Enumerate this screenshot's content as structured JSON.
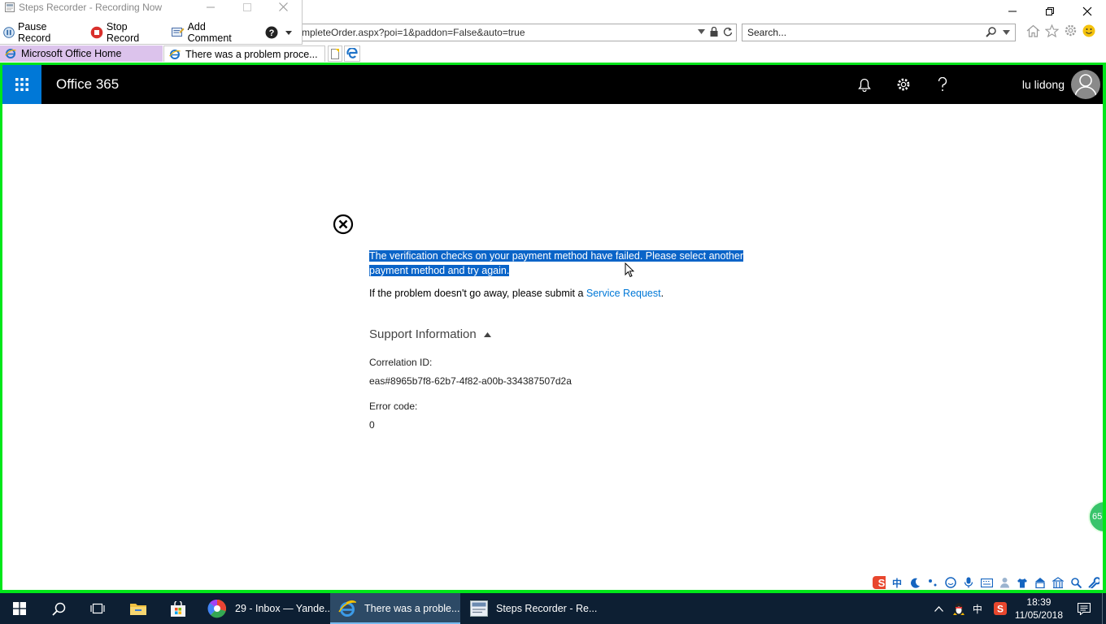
{
  "steps_recorder": {
    "title": "Steps Recorder - Recording Now",
    "pause_label": "Pause Record",
    "stop_label": "Stop Record",
    "comment_label": "Add Comment"
  },
  "browser": {
    "url": "mpleteOrder.aspx?poi=1&paddon=False&auto=true",
    "search_placeholder": "Search...",
    "tabs": [
      {
        "label": "Microsoft Office Home"
      },
      {
        "label": "There was a problem proce..."
      }
    ]
  },
  "o365": {
    "brand": "Office 365",
    "user_name": "lu lidong"
  },
  "error": {
    "message": "The verification checks on your payment method have failed. Please select another payment method and try again.",
    "help_prefix": "If the problem doesn't go away, please submit a ",
    "help_link": "Service Request",
    "help_suffix": ".",
    "support_heading": "Support Information",
    "correlation_label": "Correlation ID:",
    "correlation_value": "eas#8965b7f8-62b7-4f82-a00b-334387507d2a",
    "error_code_label": "Error code:",
    "error_code_value": "0"
  },
  "side_badge": "65",
  "ime": {
    "lang": "中"
  },
  "taskbar": {
    "apps": [
      {
        "label": "29 - Inbox — Yande...",
        "icon": "yandex-browser-icon"
      },
      {
        "label": "There was a proble...",
        "icon": "internet-explorer-icon"
      },
      {
        "label": "Steps Recorder - Re...",
        "icon": "steps-recorder-icon"
      }
    ],
    "tray_lang": "中",
    "time": "18:39",
    "date": "11/05/2018"
  },
  "colors": {
    "o365_blue": "#0078d7",
    "viewport_border": "#00e61a",
    "selection": "#0a64c8",
    "taskbar": "#0d1f33"
  }
}
